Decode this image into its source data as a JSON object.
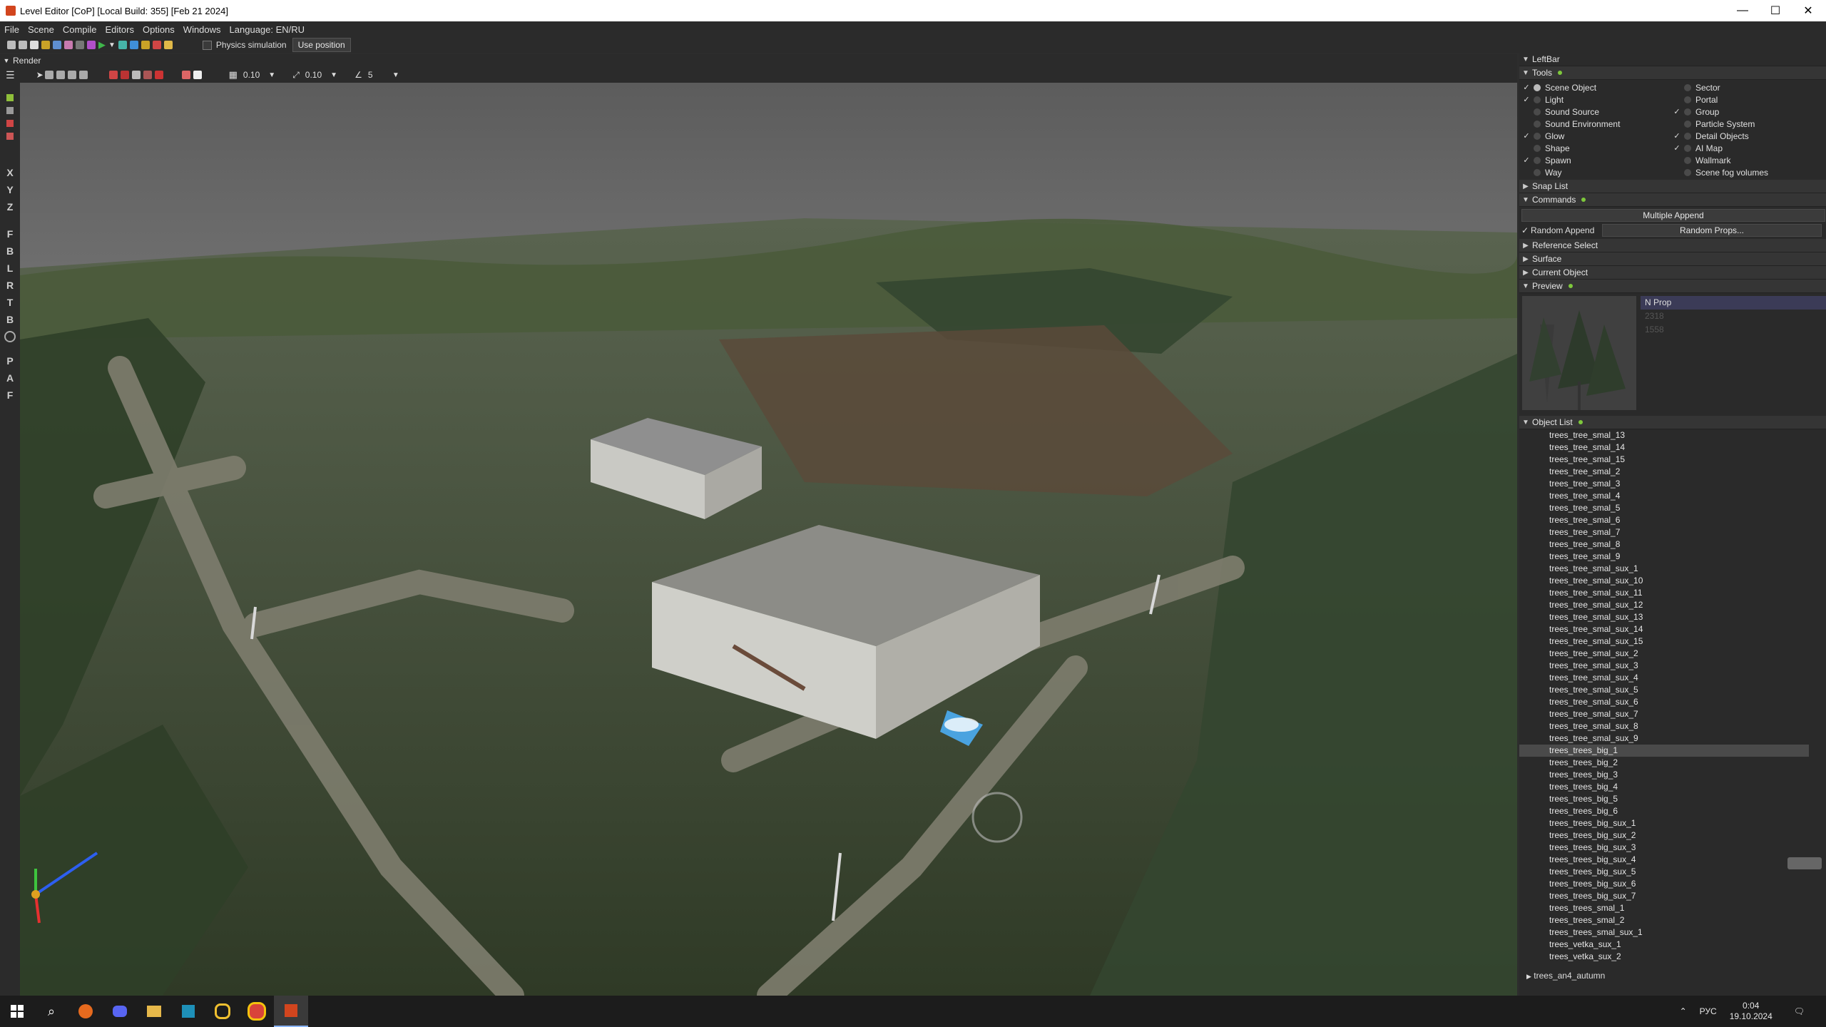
{
  "window": {
    "title": "Level Editor [CoP] [Local Build: 355] [Feb 21 2024]",
    "minimize": "—",
    "maximize": "☐",
    "close": "✕"
  },
  "menu": [
    "File",
    "Scene",
    "Compile",
    "Editors",
    "Options",
    "Windows",
    "Language: EN/RU"
  ],
  "toolbar": {
    "physics_label": "Physics simulation",
    "use_position": "Use position"
  },
  "render_section": "Render",
  "viewport_toolbar": {
    "grid_step": "0.10",
    "scale_step": "0.10",
    "angle_step": "5"
  },
  "left_strip": [
    "X",
    "Y",
    "Z",
    "F",
    "B",
    "L",
    "R",
    "T",
    "B",
    "P",
    "A",
    "F"
  ],
  "sidebar": {
    "title": "LeftBar",
    "tools_label": "Tools",
    "tools_left": [
      {
        "label": "Scene Object",
        "checked": "✓"
      },
      {
        "label": "Light",
        "checked": "✓"
      },
      {
        "label": "Sound Source",
        "checked": ""
      },
      {
        "label": "Sound Environment",
        "checked": ""
      },
      {
        "label": "Glow",
        "checked": "✓"
      },
      {
        "label": "Shape",
        "checked": ""
      },
      {
        "label": "Spawn",
        "checked": "✓"
      },
      {
        "label": "Way",
        "checked": ""
      }
    ],
    "tools_right": [
      {
        "label": "Sector",
        "checked": ""
      },
      {
        "label": "Portal",
        "checked": ""
      },
      {
        "label": "Group",
        "checked": "✓"
      },
      {
        "label": "Particle System",
        "checked": ""
      },
      {
        "label": "Detail Objects",
        "checked": "✓"
      },
      {
        "label": "AI Map",
        "checked": "✓"
      },
      {
        "label": "Wallmark",
        "checked": ""
      },
      {
        "label": "Scene fog volumes",
        "checked": ""
      }
    ],
    "snap_list": "Snap List",
    "commands": "Commands",
    "multiple_append": "Multiple Append",
    "random_append": "Random Append",
    "random_props": "Random Props...",
    "reference_select": "Reference Select",
    "surface": "Surface",
    "current_object": "Current Object",
    "preview": "Preview",
    "preview_items": [
      "N Prop",
      "2318",
      "1558"
    ],
    "object_list": "Object List",
    "objects": [
      "trees_tree_smal_13",
      "trees_tree_smal_14",
      "trees_tree_smal_15",
      "trees_tree_smal_2",
      "trees_tree_smal_3",
      "trees_tree_smal_4",
      "trees_tree_smal_5",
      "trees_tree_smal_6",
      "trees_tree_smal_7",
      "trees_tree_smal_8",
      "trees_tree_smal_9",
      "trees_tree_smal_sux_1",
      "trees_tree_smal_sux_10",
      "trees_tree_smal_sux_11",
      "trees_tree_smal_sux_12",
      "trees_tree_smal_sux_13",
      "trees_tree_smal_sux_14",
      "trees_tree_smal_sux_15",
      "trees_tree_smal_sux_2",
      "trees_tree_smal_sux_3",
      "trees_tree_smal_sux_4",
      "trees_tree_smal_sux_5",
      "trees_tree_smal_sux_6",
      "trees_tree_smal_sux_7",
      "trees_tree_smal_sux_8",
      "trees_tree_smal_sux_9",
      "trees_trees_big_1",
      "trees_trees_big_2",
      "trees_trees_big_3",
      "trees_trees_big_4",
      "trees_trees_big_5",
      "trees_trees_big_6",
      "trees_trees_big_sux_1",
      "trees_trees_big_sux_2",
      "trees_trees_big_sux_3",
      "trees_trees_big_sux_4",
      "trees_trees_big_sux_5",
      "trees_trees_big_sux_6",
      "trees_trees_big_sux_7",
      "trees_trees_smal_1",
      "trees_trees_smal_2",
      "trees_trees_smal_sux_1",
      "trees_vetka_sux_1",
      "trees_vetka_sux_2"
    ],
    "selected_object": "trees_trees_big_1",
    "folder": "trees_an4_autumn"
  },
  "taskbar": {
    "lang": "РУС",
    "time": "0:04",
    "date": "19.10.2024"
  }
}
